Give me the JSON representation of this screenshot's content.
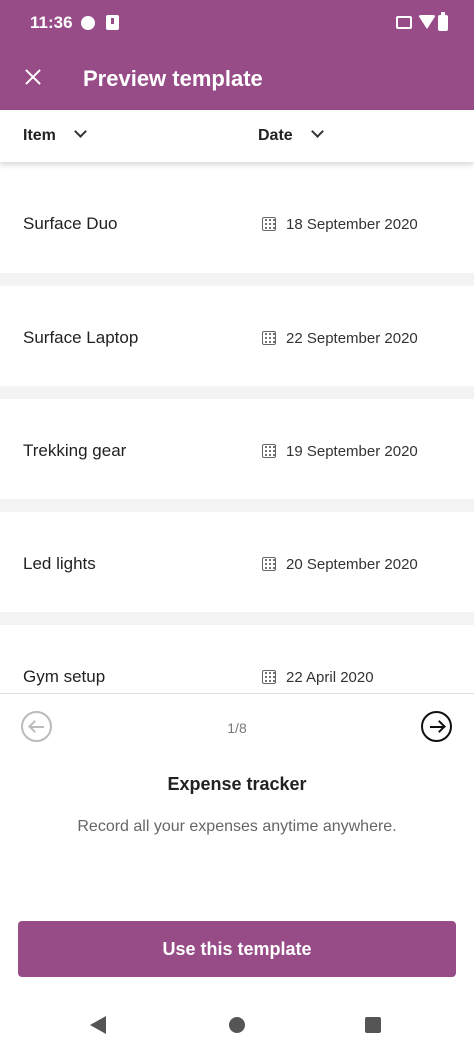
{
  "status_bar": {
    "time": "11:36",
    "icons": [
      "notification-dot-icon",
      "alert-icon",
      "cast-icon",
      "wifi-icon",
      "battery-icon"
    ]
  },
  "app_bar": {
    "title": "Preview template",
    "close_icon": "close-icon",
    "color": "#974c88"
  },
  "columns": {
    "item_label": "Item",
    "date_label": "Date"
  },
  "rows": [
    {
      "item": "Surface Duo",
      "date": "18 September 2020"
    },
    {
      "item": "Surface Laptop",
      "date": "22 September 2020"
    },
    {
      "item": "Trekking gear",
      "date": "19 September 2020"
    },
    {
      "item": "Led lights",
      "date": "20 September 2020"
    },
    {
      "item": "Gym setup",
      "date": "22 April 2020"
    }
  ],
  "pager": {
    "counter": "1/8"
  },
  "template": {
    "title": "Expense tracker",
    "description": "Record all your expenses anytime anywhere."
  },
  "cta": {
    "label": "Use this template"
  },
  "system_nav": [
    "back-icon",
    "home-icon",
    "recents-icon"
  ]
}
